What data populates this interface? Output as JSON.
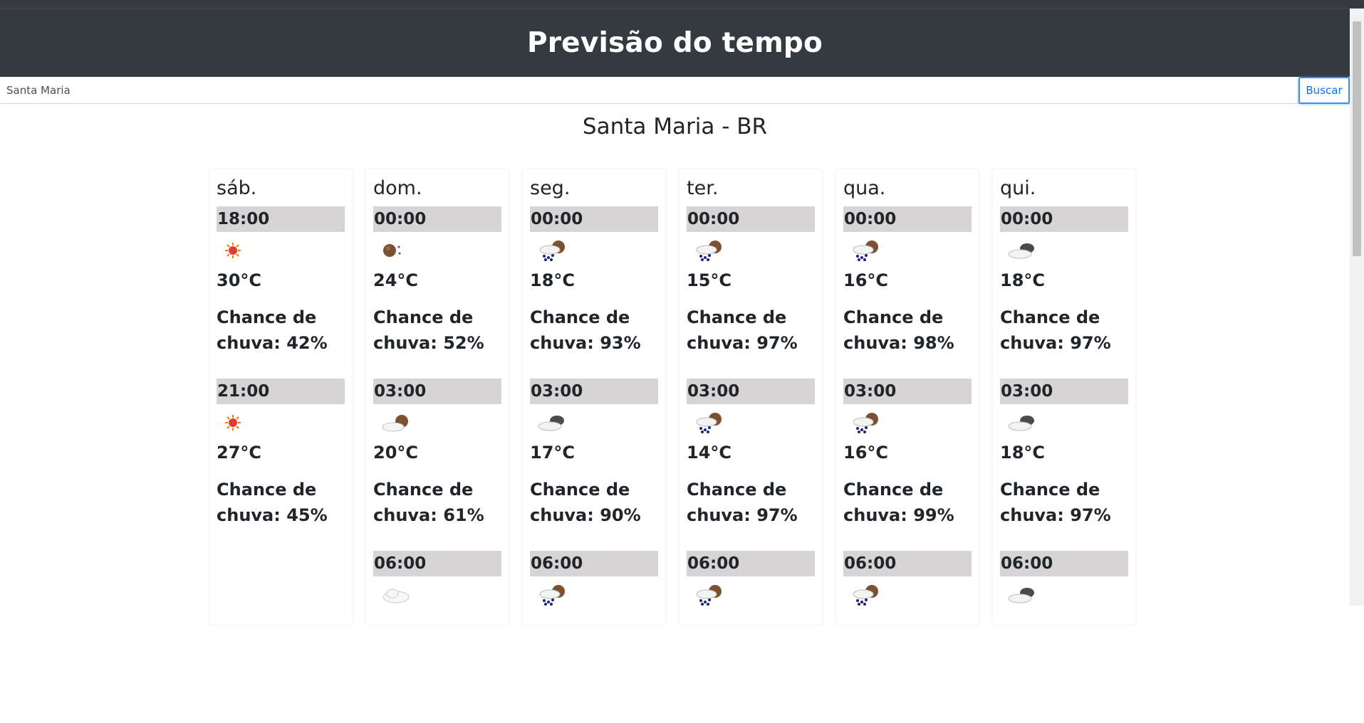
{
  "header": {
    "title": "Previsão do tempo"
  },
  "search": {
    "value": "Santa Maria",
    "button_label": "Buscar"
  },
  "city": "Santa Maria - BR",
  "days": [
    {
      "name": "sáb.",
      "slots": [
        {
          "time": "18:00",
          "icon": "sun-icon",
          "temp": "30°C",
          "rain": "Chance de chuva: 42%"
        },
        {
          "time": "21:00",
          "icon": "sun-icon",
          "temp": "27°C",
          "rain": "Chance de chuva: 45%"
        }
      ]
    },
    {
      "name": "dom.",
      "slots": [
        {
          "time": "00:00",
          "icon": "moon-icon",
          "temp": "24°C",
          "rain": "Chance de chuva: 52%"
        },
        {
          "time": "03:00",
          "icon": "moon-cloud-icon",
          "temp": "20°C",
          "rain": "Chance de chuva: 61%"
        },
        {
          "time": "06:00",
          "icon": "cloud-icon"
        }
      ]
    },
    {
      "name": "seg.",
      "slots": [
        {
          "time": "00:00",
          "icon": "rain-moon-icon",
          "temp": "18°C",
          "rain": "Chance de chuva: 93%"
        },
        {
          "time": "03:00",
          "icon": "dark-cloud-icon",
          "temp": "17°C",
          "rain": "Chance de chuva: 90%"
        },
        {
          "time": "06:00",
          "icon": "rain-moon-icon"
        }
      ]
    },
    {
      "name": "ter.",
      "slots": [
        {
          "time": "00:00",
          "icon": "rain-moon-icon",
          "temp": "15°C",
          "rain": "Chance de chuva: 97%"
        },
        {
          "time": "03:00",
          "icon": "rain-moon-icon",
          "temp": "14°C",
          "rain": "Chance de chuva: 97%"
        },
        {
          "time": "06:00",
          "icon": "rain-moon-icon"
        }
      ]
    },
    {
      "name": "qua.",
      "slots": [
        {
          "time": "00:00",
          "icon": "rain-moon-icon",
          "temp": "16°C",
          "rain": "Chance de chuva: 98%"
        },
        {
          "time": "03:00",
          "icon": "rain-moon-icon",
          "temp": "16°C",
          "rain": "Chance de chuva: 99%"
        },
        {
          "time": "06:00",
          "icon": "rain-moon-icon"
        }
      ]
    },
    {
      "name": "qui.",
      "slots": [
        {
          "time": "00:00",
          "icon": "dark-cloud-icon",
          "temp": "18°C",
          "rain": "Chance de chuva: 97%"
        },
        {
          "time": "03:00",
          "icon": "dark-cloud-icon",
          "temp": "18°C",
          "rain": "Chance de chuva: 97%"
        },
        {
          "time": "06:00",
          "icon": "dark-cloud-icon"
        }
      ]
    }
  ]
}
